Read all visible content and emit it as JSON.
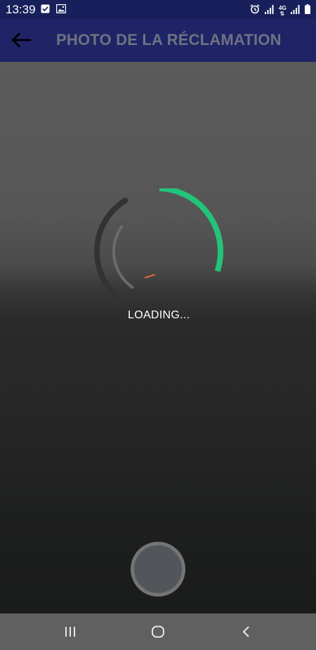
{
  "status_bar": {
    "time": "13:39",
    "left_icons": [
      "checkbox-notification-icon",
      "gallery-notification-icon"
    ],
    "right_icons": [
      "alarm-icon",
      "signal-icon",
      "4g-data-icon",
      "signal-icon",
      "battery-icon"
    ],
    "network_label": "4G"
  },
  "app_bar": {
    "title": "PHOTO DE LA RÉCLAMATION",
    "back_icon": "arrow-left-icon",
    "background": "#1f2467",
    "title_color": "#6e7280"
  },
  "camera": {
    "loading_text": "LOADING...",
    "loader_colors": {
      "outer_arc": "#333333",
      "inner_arc": "#6b6b6b",
      "progress_arc": "#22c47a",
      "accent": "#e0693e"
    }
  },
  "shutter": {
    "icon": "shutter-button"
  },
  "nav_bar": {
    "buttons": [
      "recent-apps-icon",
      "home-icon",
      "back-icon"
    ]
  }
}
